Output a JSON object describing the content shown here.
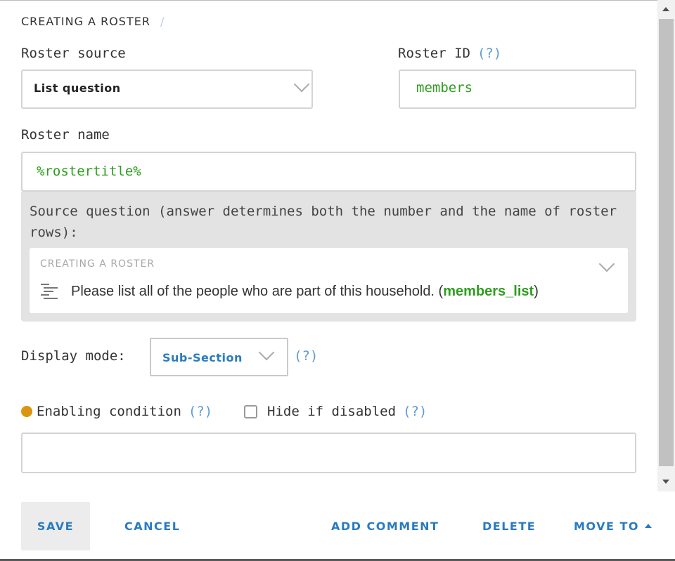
{
  "breadcrumb": {
    "section": "CREATING A ROSTER",
    "separator": "/"
  },
  "roster_source": {
    "label": "Roster source",
    "value": "List question"
  },
  "roster_id": {
    "label": "Roster ID",
    "help": "(?)",
    "value": "members"
  },
  "roster_name": {
    "label": "Roster name",
    "value": "%rostertitle%"
  },
  "source_question": {
    "description": "Source question (answer determines both the number and the name of roster rows):",
    "section": "CREATING A ROSTER",
    "question_text": "Please list all of the people who are part of this household. (",
    "variable": "members_list",
    "closing": ")"
  },
  "display_mode": {
    "label": "Display mode:",
    "value": "Sub-Section",
    "help": "(?)"
  },
  "enabling_condition": {
    "label": "Enabling condition",
    "help": "(?)",
    "value": ""
  },
  "hide_if_disabled": {
    "label": "Hide if disabled",
    "help": "(?)",
    "checked": false
  },
  "actions": {
    "save": "SAVE",
    "cancel": "CANCEL",
    "add_comment": "ADD COMMENT",
    "delete": "DELETE",
    "move_to": "MOVE TO"
  },
  "colors": {
    "accent": "#2a7bc0",
    "variable_green": "#2e9e1e",
    "condition_dot": "#d9960e",
    "help": "#5b9bd5"
  },
  "icons": [
    "chevron-down-icon",
    "list-icon",
    "caret-up-icon",
    "scroll-up-arrow-icon",
    "scroll-down-arrow-icon"
  ]
}
